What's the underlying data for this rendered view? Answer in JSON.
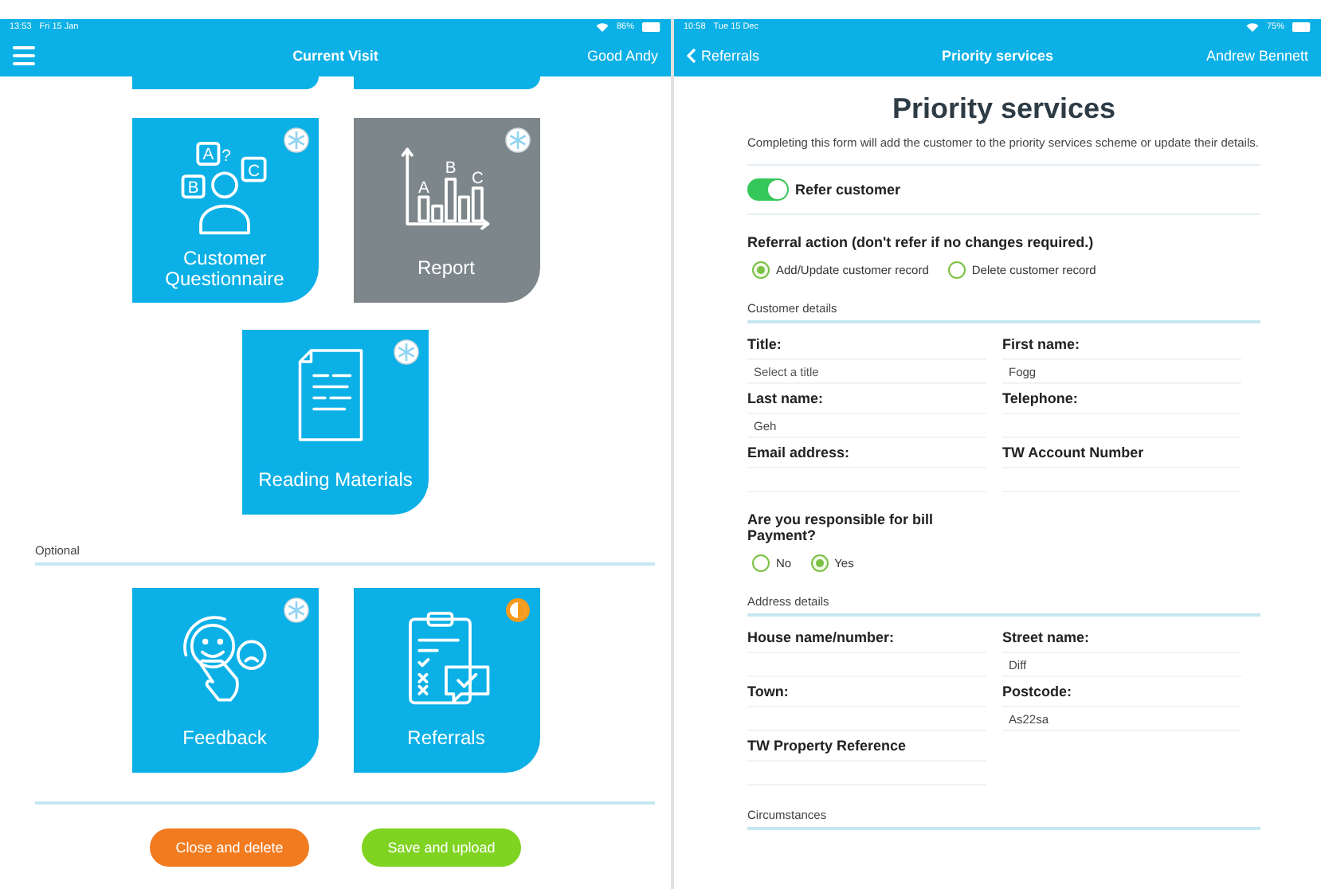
{
  "left": {
    "status_bar": {
      "time": "13:53",
      "date": "Fri 15 Jan",
      "battery": "86%"
    },
    "nav": {
      "title": "Current Visit",
      "user": "Good Andy"
    },
    "tiles": [
      {
        "label": "Customer Questionnaire",
        "kind": "questionnaire",
        "icon_letters": [
          "A",
          "?",
          "B",
          "C"
        ],
        "disabled": false,
        "in_progress": false
      },
      {
        "label": "Report",
        "kind": "report",
        "icon_letters": [
          "A",
          "B",
          "C"
        ],
        "disabled": true,
        "in_progress": false
      },
      {
        "label": "Reading Materials",
        "kind": "document",
        "disabled": false,
        "in_progress": false
      }
    ],
    "optional_label": "Optional",
    "optional_tiles": [
      {
        "label": "Feedback",
        "kind": "feedback",
        "disabled": false,
        "in_progress": false
      },
      {
        "label": "Referrals",
        "kind": "referrals",
        "disabled": false,
        "in_progress": true
      }
    ],
    "buttons": [
      {
        "label": "Close and delete",
        "kind": "danger"
      },
      {
        "label": "Save and upload",
        "kind": "confirm"
      }
    ]
  },
  "right": {
    "status_bar": {
      "time": "10:58",
      "date": "Tue 15 Dec",
      "battery": "75%"
    },
    "nav": {
      "back": "Referrals",
      "title": "Priority services",
      "user": "Andrew Bennett"
    },
    "heading": "Priority services",
    "intro": "Completing this form will add the customer to the priority services scheme or update their details.",
    "toggle": {
      "label": "Refer customer",
      "on": true
    },
    "items": [
      {
        "kind": "question",
        "label": "Referral action (don't refer if no changes required.)",
        "options": [
          {
            "label": "Add/Update customer record",
            "selected": true
          },
          {
            "label": "Delete customer record",
            "selected": false
          }
        ]
      },
      {
        "kind": "section",
        "title": "Customer details"
      },
      {
        "kind": "fields",
        "fields": [
          {
            "label": "Title:",
            "placeholder": "Select a title"
          },
          {
            "label": "First name:",
            "value": "Fogg"
          },
          {
            "label": "Last name:",
            "value": "Geh"
          },
          {
            "label": "Telephone:"
          },
          {
            "label": "Email address:"
          },
          {
            "label": "TW Account Number"
          }
        ]
      },
      {
        "kind": "narrow_question",
        "label": "Are you responsible for bill Payment?",
        "options": [
          {
            "label": "No",
            "selected": false
          },
          {
            "label": "Yes",
            "selected": true
          }
        ]
      },
      {
        "kind": "section",
        "title": "Address details"
      },
      {
        "kind": "fields",
        "fields": [
          {
            "label": "House name/number:"
          },
          {
            "label": "Street name:",
            "value": "Diff"
          },
          {
            "label": "Town:"
          },
          {
            "label": "Postcode:",
            "value": "As22sa"
          },
          {
            "label": "TW Property Reference"
          }
        ]
      },
      {
        "kind": "section",
        "title": "Circumstances"
      }
    ]
  }
}
